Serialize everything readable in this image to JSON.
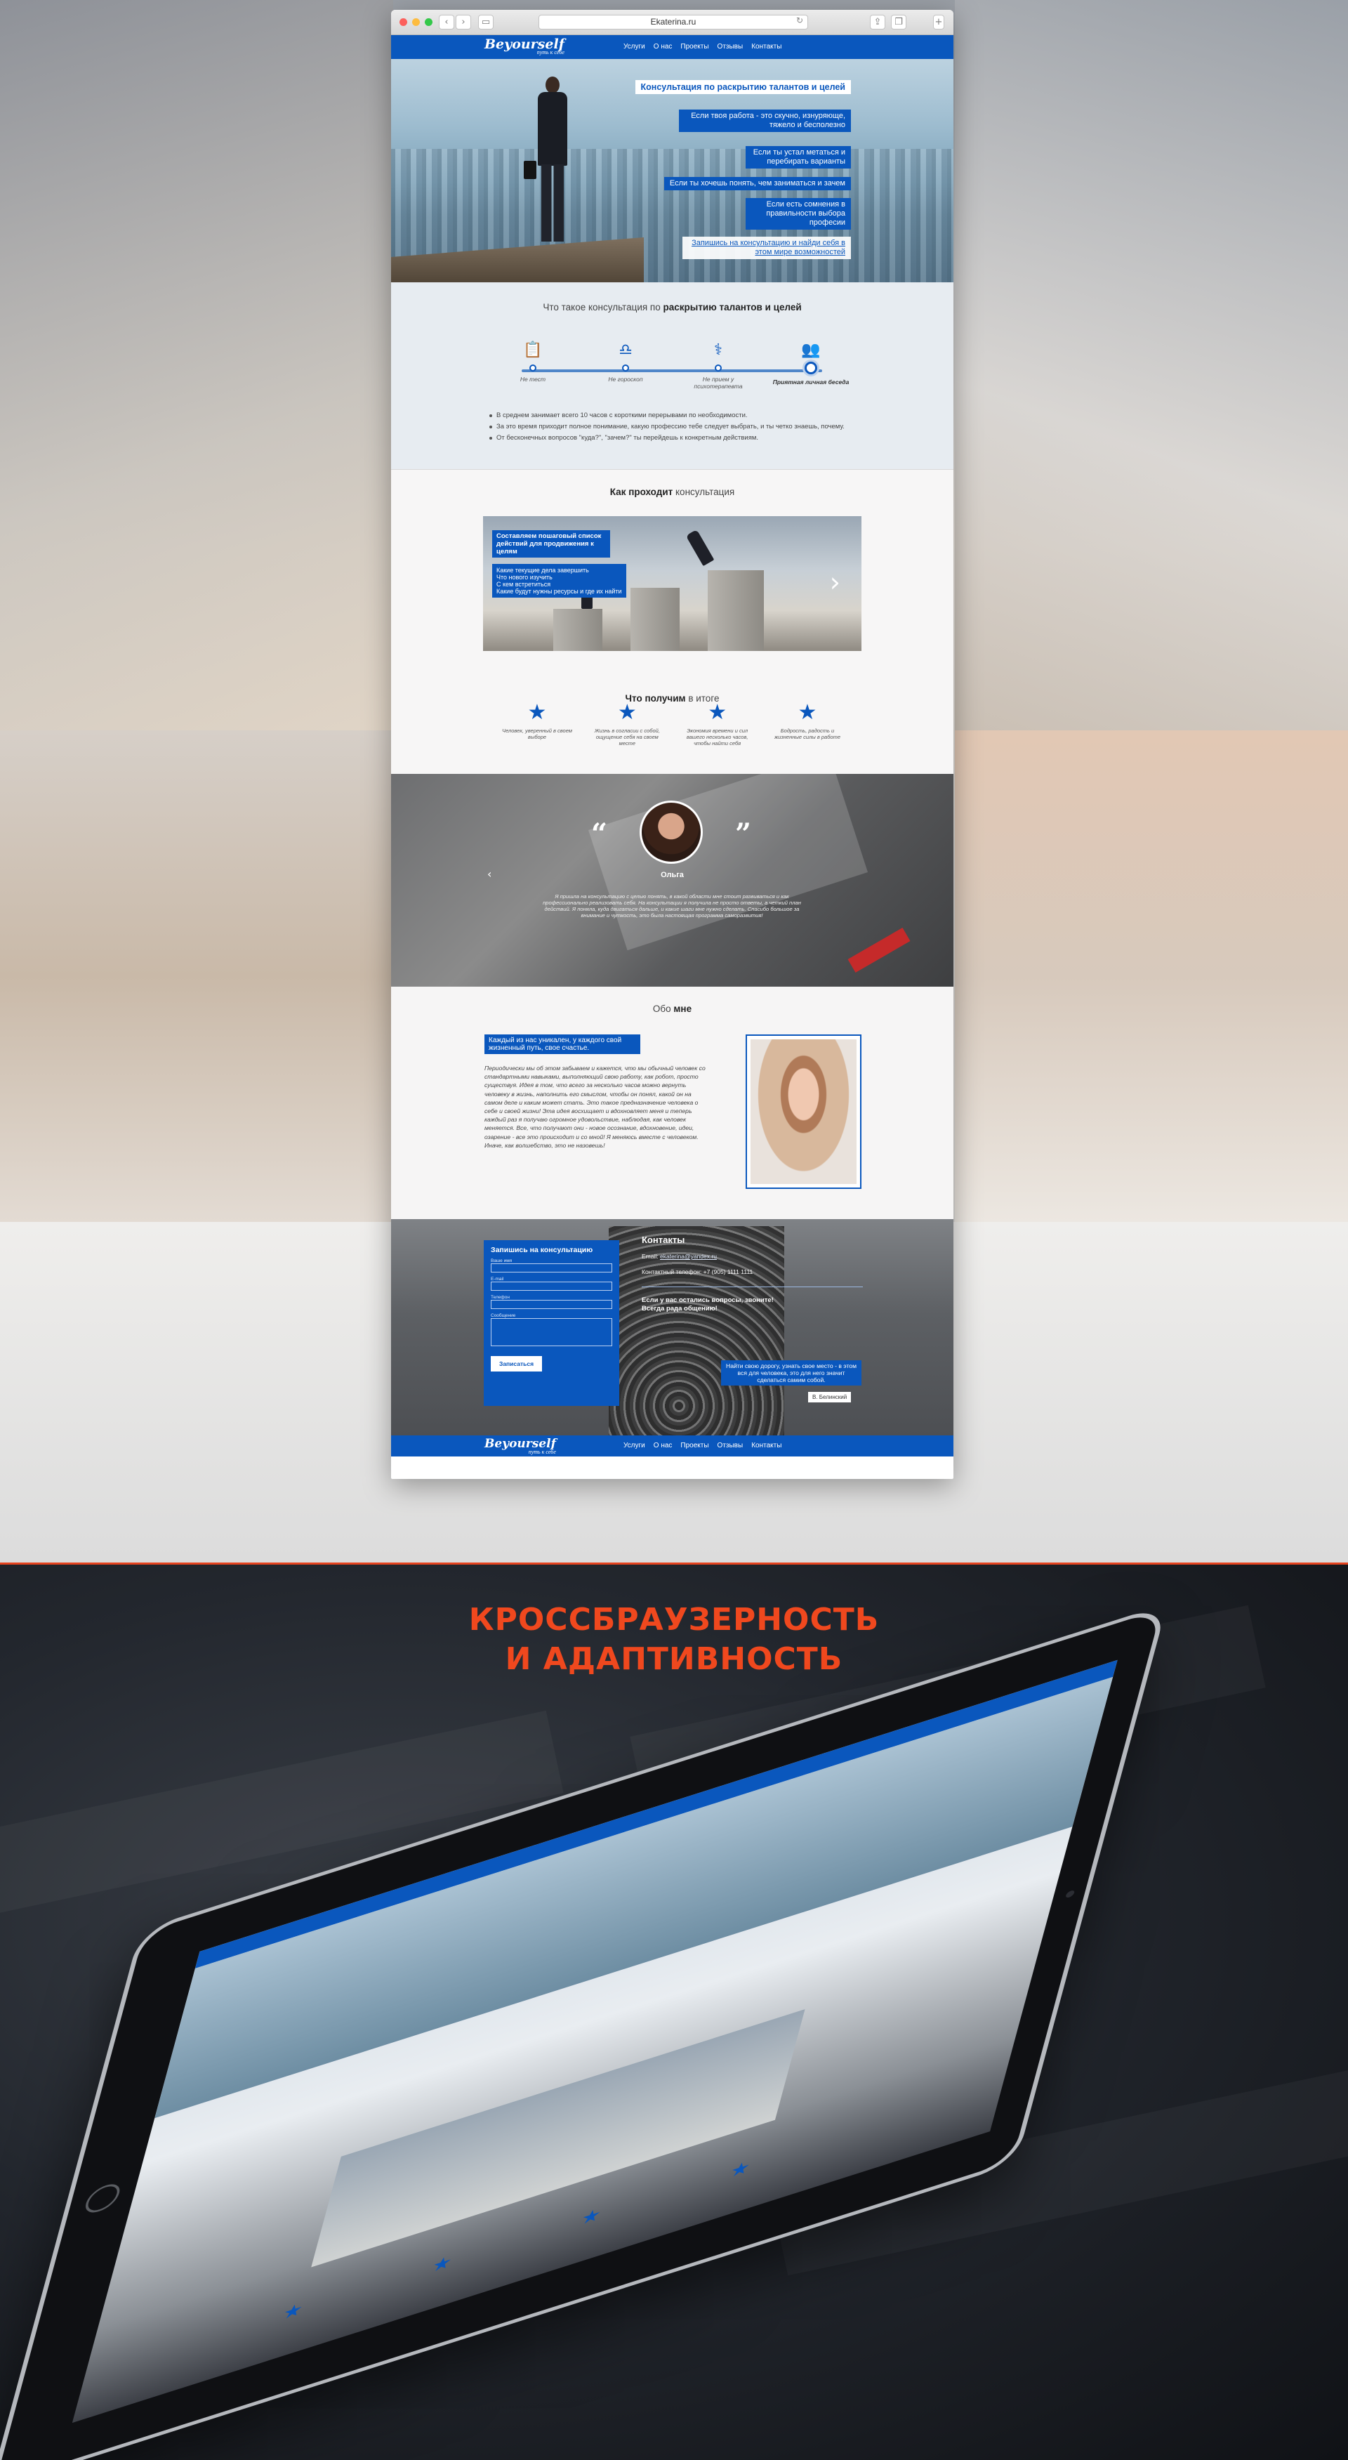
{
  "browser": {
    "url": "Ekaterina.ru",
    "back_icon": "chevron-left-icon",
    "forward_icon": "chevron-right-icon",
    "reload_icon": "reload-icon"
  },
  "site": {
    "logo": "Beyourself",
    "logo_tagline": "путь к себе",
    "menu": [
      "Услуги",
      "О нас",
      "Проекты",
      "Отзывы",
      "Контакты"
    ]
  },
  "hero": {
    "title": "Консультация по раскрытию талантов и целей",
    "items": [
      "Если твоя работа - это скучно, изнуряюще, тяжело и бесполезно",
      "Если ты устал метаться и перебирать варианты",
      "Если ты хочешь понять, чем заниматься и зачем",
      "Если есть сомнения в правильности выбора професии"
    ],
    "link": "Запишись на консультацию и найди себя в этом мире возможностей"
  },
  "whatis": {
    "title_pre": "Что такое консультация по",
    "title_bold": "раскрытию талантов и целей",
    "steps": [
      {
        "icon": "test-icon",
        "label": "Не тест"
      },
      {
        "icon": "horoscope-icon",
        "label": "Не гороскоп"
      },
      {
        "icon": "psychotherapist-icon",
        "label": "Не прием у психотерапевта"
      },
      {
        "icon": "people-icon",
        "label": "Приятная личная беседа"
      }
    ],
    "bullets": [
      "В среднем занимает всего 10 часов с короткими перерывами по необходимости.",
      "За это время приходит полное понимание, какую профессию тебе следует выбрать, и ты четко знаешь, почему.",
      "От бесконечных вопросов \"куда?\", \"зачем?\" ты перейдешь к конкретным действиям."
    ]
  },
  "how": {
    "title_bold": "Как проходит",
    "title_rest": "консультация",
    "slide_caption": "Составляем пошаговый список действий для продвижения к целям",
    "slide_list": [
      "Какие текущие дела завершить",
      "Что нового изучить",
      "С кем встретиться",
      "Какие будут нужны ресурсы и где их найти"
    ],
    "next_icon": "chevron-right-icon"
  },
  "get": {
    "title_bold": "Что получим",
    "title_rest": "в итоге",
    "items": [
      "Человек, уверенный в своем выборе",
      "Жизнь в согласии с собой, ощущение себя на своем месте",
      "Экономия времени и сил вашего несколько часов, чтобы найти себя",
      "Бодрость, радость и жизненные силы в работе"
    ]
  },
  "testimonial": {
    "name": "Ольга",
    "text": "Я пришла на консультацию с целью понять, в какой области мне стоит развиваться и как профессионально реализовать себя. На консультации я получила не просто ответы, а четкий план действий. Я поняла, куда двигаться дальше, и какие шаги мне нужно сделать. Спасибо большое за внимание и чуткость, это была настоящая программа саморазвития!",
    "prev_icon": "chevron-left-icon"
  },
  "about": {
    "title_pre": "Обо",
    "title_bold": "мне",
    "caption": "Каждый из нас уникален, у каждого свой жизненный путь, свое счастье.",
    "text": "Периодически мы об этом забываем и кажется, что мы обычный человек со стандартными навыками, выполняющий свою работу, как робот, просто существуя. Идея в том, что всего за несколько часов можно вернуть человеку в жизнь, наполнить его смыслом, чтобы он понял, какой он на самом деле и каким может стать. Это такое предназначение человека о себе и своей жизни! Эта идея восхищает и вдохновляет меня и теперь каждый раз я получаю огромное удовольствие, наблюдая, как человек меняется. Все, что получают они - новое осознание, вдохновение, идеи, озарение - все это происходит и со мной! Я меняюсь вместе с человеком. Иначе, как волшебство, это не назовешь!"
  },
  "contacts": {
    "form_title": "Запишись на консультацию",
    "fields": [
      "Ваше имя",
      "E-mail",
      "Телефон",
      "Сообщение"
    ],
    "submit": "Записаться",
    "title": "Контакты",
    "email_label": "Email:",
    "email": "ekaterina@yandex.ru",
    "phone_label": "Контактный телефон:",
    "phone": "+7 (905) 1111 1111",
    "call_text": "Если у вас остались вопросы, звоните! Всегда рада общению!",
    "quote": "Найти свою дорогу, узнать свое место - в этом вся для человека, это для него значит сделаться самим собой.",
    "quote_author": "В. Белинский"
  },
  "promo": {
    "headline_1": "КРОССБРАУЗЕРНОСТЬ",
    "headline_2": "И АДАПТИВНОСТЬ"
  },
  "colors": {
    "brand": "#0a57bd",
    "accent": "#f0481e"
  }
}
